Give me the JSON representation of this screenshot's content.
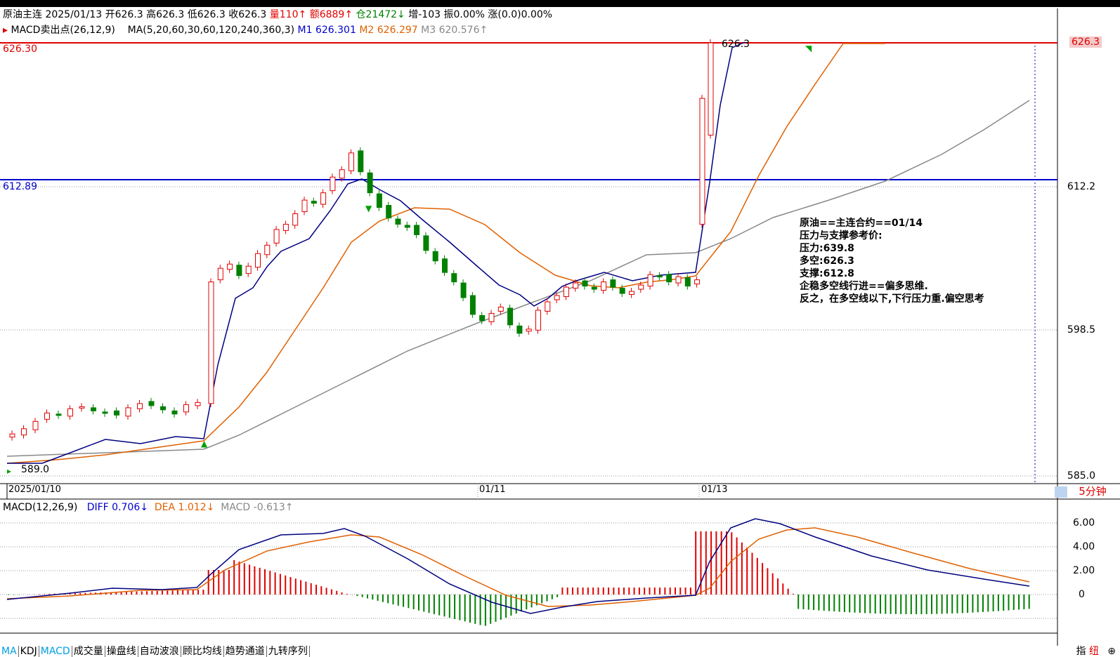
{
  "header": {
    "symbol": "原油主连",
    "date": "2025/01/13",
    "open_label": "开",
    "open": "626.3",
    "high_label": "高",
    "high": "626.3",
    "low_label": "低",
    "low": "626.3",
    "close_label": "收",
    "close": "626.3",
    "vol_label": "量",
    "vol": "110↑",
    "amount_label": "额",
    "amount": "6889↑",
    "oi_label": "仓",
    "oi": "21472↓",
    "inc_label": "增",
    "inc": "-103",
    "amp_label": "振",
    "amp": "0.00%",
    "chg_label": "涨",
    "chg": "(0.0)0.00%"
  },
  "indicators": {
    "macd_signal": "MACD卖出点(26,12,9)",
    "ma_params": "MA(5,20,60,30,60,120,240,360,3)",
    "m1_label": "M1",
    "m1": "626.301",
    "m2_label": "M2",
    "m2": "626.297",
    "m3_label": "M3",
    "m3": "620.576↑"
  },
  "price_lines": {
    "red_value": "626.30",
    "blue_value": "612.89",
    "right_red": "626.3",
    "latest_label": "626.3",
    "low_label": "589.0"
  },
  "y_axis": [
    "612.2",
    "598.5",
    "585.0"
  ],
  "x_axis": [
    "2025/01/10",
    "01/11",
    "01/13"
  ],
  "period": "5分钟",
  "annotation": [
    "原油==主连合约==01/14",
    "压力与支撑参考价:",
    "压力:639.8",
    "多空:626.3",
    "支撑:612.8",
    "企稳多空线行进==偏多思维.",
    "反之，在多空线以下,下行压力重.偏空思考"
  ],
  "macd": {
    "title": "MACD(12,26,9)",
    "diff_label": "DIFF",
    "diff": "0.706↓",
    "dea_label": "DEA",
    "dea": "1.012↓",
    "macd_label": "MACD",
    "macd": "-0.613↑",
    "y_axis": [
      "6.00",
      "4.00",
      "2.00",
      "0"
    ]
  },
  "tabs": [
    "MA",
    "KDJ",
    "MACD",
    "成交量",
    "操盘线",
    "自动波浪",
    "顾比均线",
    "趋势通道",
    "九转序列"
  ],
  "right_labels": [
    "指",
    "纽"
  ],
  "colors": {
    "up": "#e00000",
    "down": "#008000",
    "m1": "#000080",
    "m2": "#e06000",
    "m3": "#888888",
    "hline_red": "#e00000",
    "hline_blue": "#0000cc"
  },
  "chart_data": {
    "type": "candlestick",
    "price_range": [
      585.0,
      626.3
    ],
    "candles_close": [
      589.0,
      589.5,
      590.2,
      591.0,
      590.8,
      591.4,
      591.6,
      591.2,
      591.0,
      590.8,
      591.5,
      591.9,
      591.7,
      591.3,
      590.9,
      591.8,
      592.0,
      603.5,
      604.8,
      605.2,
      604.1,
      605.0,
      606.2,
      607.0,
      608.5,
      609.0,
      610.0,
      611.3,
      611.0,
      612.0,
      613.5,
      614.2,
      615.8,
      614.0,
      612.0,
      610.6,
      609.6,
      609.0,
      608.7,
      608.0,
      606.5,
      605.5,
      604.4,
      603.5,
      602.0,
      600.4,
      599.8,
      600.5,
      601.1,
      599.4,
      598.6,
      599.0,
      600.8,
      601.6,
      602.2,
      603.0,
      603.4,
      603.1,
      602.8,
      603.5,
      603.0,
      602.4,
      602.6,
      603.2,
      604.2,
      604.0,
      603.5,
      604.0,
      603.1,
      603.7,
      621.0,
      626.3
    ],
    "m1_label": "M1 626.301",
    "m2_label": "M2 626.297",
    "m3_label": "M3 620.576",
    "resistance": 639.8,
    "pivot": 626.3,
    "support": 612.8
  }
}
